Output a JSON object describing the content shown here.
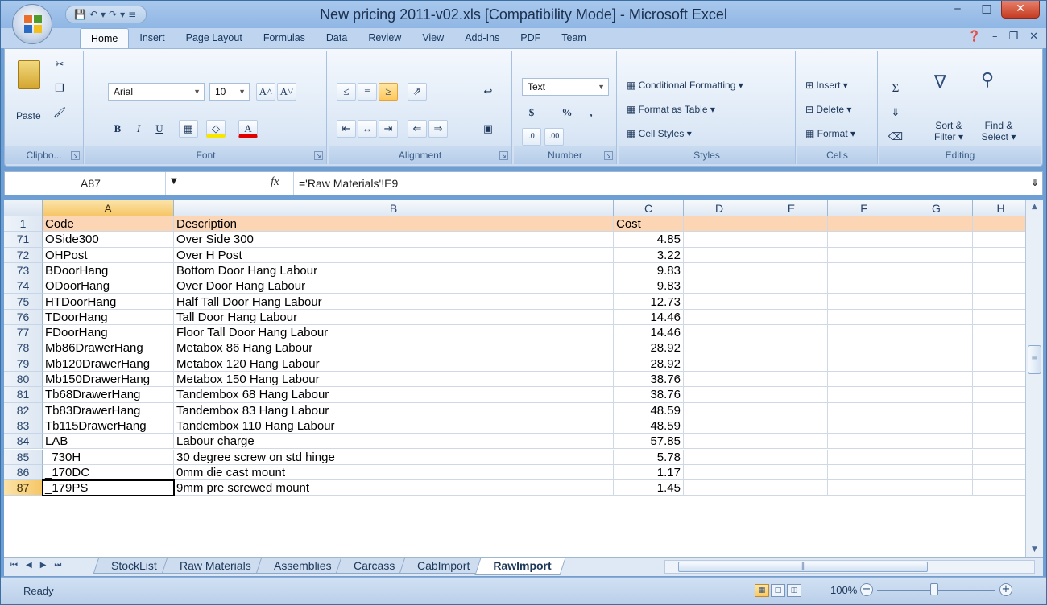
{
  "window": {
    "title": "New pricing 2011-v02.xls  [Compatibility Mode] - Microsoft Excel",
    "minimize": "‒",
    "maximize": "□",
    "close": "✕"
  },
  "ribbon_tabs": [
    "Home",
    "Insert",
    "Page Layout",
    "Formulas",
    "Data",
    "Review",
    "View",
    "Add-Ins",
    "PDF",
    "Team"
  ],
  "ribbon": {
    "clipboard": {
      "paste": "Paste",
      "label": "Clipbo..."
    },
    "font": {
      "family": "Arial",
      "size": "10",
      "label": "Font",
      "bold": "B",
      "italic": "I",
      "underline": "U",
      "grow": "A˄",
      "shrink": "A˅"
    },
    "alignment": {
      "label": "Alignment"
    },
    "number": {
      "format": "Text",
      "currency": "$",
      "percent": "%",
      "comma": ",",
      "label": "Number"
    },
    "styles": {
      "conditional": "Conditional Formatting",
      "format_table": "Format as Table",
      "cell_styles": "Cell Styles",
      "label": "Styles"
    },
    "cells": {
      "insert": "Insert",
      "delete": "Delete",
      "format": "Format",
      "label": "Cells"
    },
    "editing": {
      "sort_top": "Sort &",
      "sort_bottom": "Filter",
      "find_top": "Find &",
      "find_bottom": "Select",
      "label": "Editing"
    }
  },
  "formula_bar": {
    "name_box": "A87",
    "fx": "fx",
    "formula": "='Raw Materials'!E9"
  },
  "columns": [
    "A",
    "B",
    "C",
    "D",
    "E",
    "F",
    "G",
    "H"
  ],
  "header_row": {
    "num": "1",
    "code": "Code",
    "description": "Description",
    "cost": "Cost"
  },
  "rows": [
    {
      "num": "71",
      "code": "OSide300",
      "description": "Over Side 300",
      "cost": "4.85"
    },
    {
      "num": "72",
      "code": "OHPost",
      "description": "Over H Post",
      "cost": "3.22"
    },
    {
      "num": "73",
      "code": "BDoorHang",
      "description": "Bottom Door Hang Labour",
      "cost": "9.83"
    },
    {
      "num": "74",
      "code": "ODoorHang",
      "description": "Over Door Hang Labour",
      "cost": "9.83"
    },
    {
      "num": "75",
      "code": "HTDoorHang",
      "description": "Half Tall Door Hang Labour",
      "cost": "12.73"
    },
    {
      "num": "76",
      "code": "TDoorHang",
      "description": "Tall Door Hang Labour",
      "cost": "14.46"
    },
    {
      "num": "77",
      "code": "FDoorHang",
      "description": "Floor Tall Door Hang Labour",
      "cost": "14.46"
    },
    {
      "num": "78",
      "code": "Mb86DrawerHang",
      "description": "Metabox 86 Hang Labour",
      "cost": "28.92"
    },
    {
      "num": "79",
      "code": "Mb120DrawerHang",
      "description": "Metabox 120 Hang Labour",
      "cost": "28.92"
    },
    {
      "num": "80",
      "code": "Mb150DrawerHang",
      "description": "Metabox 150 Hang Labour",
      "cost": "38.76"
    },
    {
      "num": "81",
      "code": "Tb68DrawerHang",
      "description": "Tandembox 68 Hang Labour",
      "cost": "38.76"
    },
    {
      "num": "82",
      "code": "Tb83DrawerHang",
      "description": "Tandembox 83 Hang Labour",
      "cost": "48.59"
    },
    {
      "num": "83",
      "code": "Tb115DrawerHang",
      "description": "Tandembox 110 Hang Labour",
      "cost": "48.59"
    },
    {
      "num": "84",
      "code": "LAB",
      "description": "Labour charge",
      "cost": "57.85"
    },
    {
      "num": "85",
      "code": "_730H",
      "description": "30 degree screw on std hinge",
      "cost": "5.78"
    },
    {
      "num": "86",
      "code": "_170DC",
      "description": "0mm die cast mount",
      "cost": "1.17"
    },
    {
      "num": "87",
      "code": "_179PS",
      "description": "9mm pre screwed mount",
      "cost": "1.45"
    }
  ],
  "sheet_tabs": [
    "StockList",
    "Raw Materials",
    "Assemblies",
    "Carcass",
    "CabImport",
    "RawImport"
  ],
  "active_sheet": "RawImport",
  "status": {
    "ready": "Ready",
    "zoom": "100%"
  }
}
